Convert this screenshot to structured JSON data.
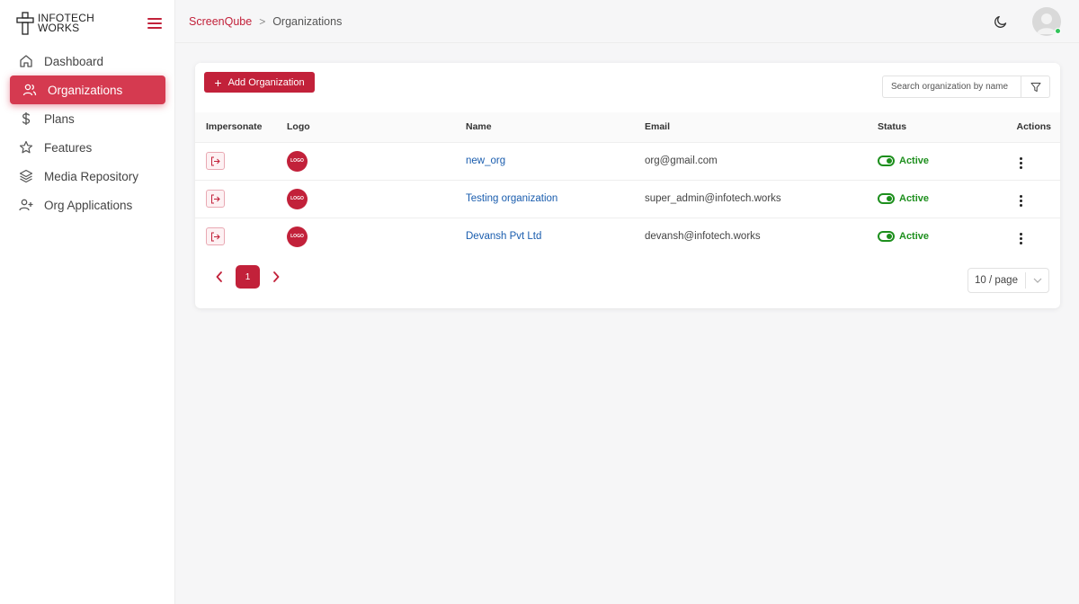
{
  "brand": {
    "name_line1": "INFOTECH",
    "name_line2": "WORKS",
    "accent": "#c2213a"
  },
  "sidebar": {
    "items": [
      {
        "label": "Dashboard",
        "icon": "home-icon",
        "active": false
      },
      {
        "label": "Organizations",
        "icon": "users-icon",
        "active": true
      },
      {
        "label": "Plans",
        "icon": "dollar-icon",
        "active": false
      },
      {
        "label": "Features",
        "icon": "star-icon",
        "active": false
      },
      {
        "label": "Media Repository",
        "icon": "layers-icon",
        "active": false
      },
      {
        "label": "Org Applications",
        "icon": "user-plus-icon",
        "active": false
      }
    ]
  },
  "header": {
    "breadcrumb": {
      "root": "ScreenQube",
      "separator": ">",
      "current": "Organizations"
    },
    "theme_icon": "moon-icon",
    "avatar_icon": "user-avatar-icon",
    "online_color": "#32c35a"
  },
  "toolbar": {
    "add_label": "Add Organization",
    "search_placeholder": "Search organization by name",
    "filter_icon": "filter-icon"
  },
  "table": {
    "columns": [
      "Impersonate",
      "Logo",
      "Name",
      "Email",
      "Status",
      "Actions"
    ],
    "rows": [
      {
        "logo": "LOGO",
        "name": "new_org",
        "email": "org@gmail.com",
        "status": "Active"
      },
      {
        "logo": "LOGO",
        "name": "Testing organization",
        "email": "super_admin@infotech.works",
        "status": "Active"
      },
      {
        "logo": "LOGO",
        "name": "Devansh Pvt Ltd",
        "email": "devansh@infotech.works",
        "status": "Active"
      }
    ],
    "status_color": "#1d8f1d",
    "link_color": "#1a5dae"
  },
  "pagination": {
    "current_page": "1",
    "page_size": "10 / page"
  }
}
